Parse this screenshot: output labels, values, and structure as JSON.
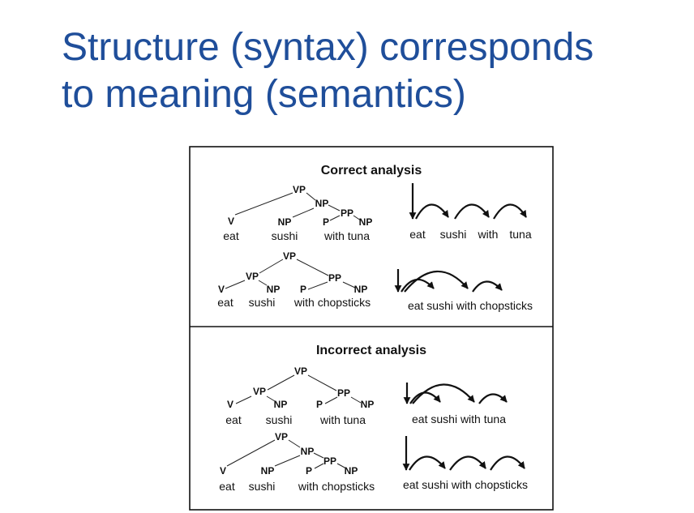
{
  "slide": {
    "title_line1": "Structure (syntax) corresponds",
    "title_line2": "to meaning (semantics)"
  },
  "figure": {
    "correct_heading": "Correct analysis",
    "incorrect_heading": "Incorrect analysis",
    "trees": {
      "t1": {
        "nodes": [
          "VP",
          "NP",
          "PP",
          "V",
          "NP",
          "P",
          "NP"
        ],
        "words": [
          "eat",
          "sushi",
          "with tuna"
        ]
      },
      "t2": {
        "nodes": [
          "VP",
          "VP",
          "PP",
          "V",
          "NP",
          "P",
          "NP"
        ],
        "words": [
          "eat",
          "sushi",
          "with chopsticks"
        ]
      },
      "t3": {
        "nodes": [
          "VP",
          "VP",
          "PP",
          "V",
          "NP",
          "P",
          "NP"
        ],
        "words": [
          "eat",
          "sushi",
          "with tuna"
        ]
      },
      "t4": {
        "nodes": [
          "VP",
          "NP",
          "PP",
          "V",
          "NP",
          "P",
          "NP"
        ],
        "words": [
          "eat",
          "sushi",
          "with chopsticks"
        ]
      }
    },
    "deps": {
      "d1": {
        "words": [
          "eat",
          "sushi",
          "with",
          "tuna"
        ]
      },
      "d2": {
        "sentence": "eat sushi with chopsticks"
      },
      "d3": {
        "sentence": "eat sushi with tuna"
      },
      "d4": {
        "sentence": "eat sushi with chopsticks"
      }
    }
  }
}
